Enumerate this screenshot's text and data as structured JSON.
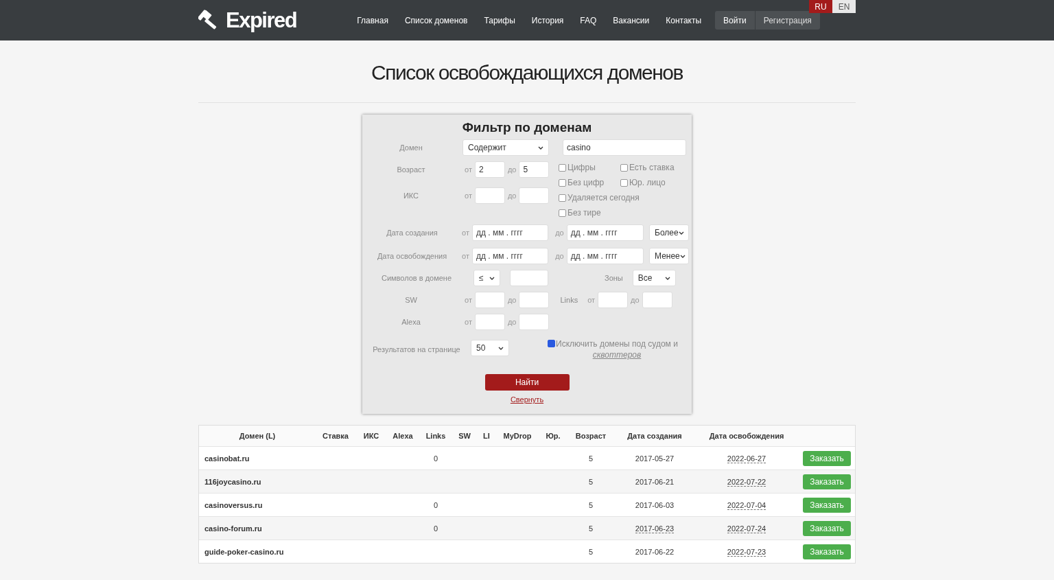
{
  "header": {
    "logo": "Expired",
    "nav": [
      "Главная",
      "Список доменов",
      "Тарифы",
      "История",
      "FAQ",
      "Вакансии",
      "Контакты"
    ],
    "login": "Войти",
    "register": "Регистрация",
    "languages": [
      {
        "label": "RU",
        "selected": true
      },
      {
        "label": "EN",
        "selected": false
      }
    ]
  },
  "page_title": "Список освобождающихся доменов",
  "filter": {
    "title": "Фильтр по доменам",
    "domain": {
      "label": "Домен",
      "mode": "Содержит",
      "value": "casino"
    },
    "age": {
      "label": "Возраст",
      "from_label": "от",
      "from": "2",
      "to_label": "до",
      "to": "5"
    },
    "iks": {
      "label": "ИКС",
      "from_label": "от",
      "to_label": "до"
    },
    "checkboxes": [
      {
        "label": "Цифры",
        "checked": false
      },
      {
        "label": "Есть ставка",
        "checked": false
      },
      {
        "label": "Без цифр",
        "checked": false
      },
      {
        "label": "Юр. лицо",
        "checked": false
      },
      {
        "label": "Удаляется сегодня",
        "checked": false
      },
      {
        "label": "Без тире",
        "checked": false
      }
    ],
    "created": {
      "label": "Дата создания",
      "from_label": "от",
      "from_placeholder": "дд . мм . гггг",
      "to_label": "до",
      "to_placeholder": "дд . мм . гггг",
      "mode": "Более"
    },
    "released": {
      "label": "Дата освобождения",
      "from_label": "от",
      "from_placeholder": "дд . мм . гггг",
      "to_label": "до",
      "to_placeholder": "дд . мм . гггг",
      "mode": "Менее"
    },
    "length": {
      "label": "Символов в домене",
      "op": "≤",
      "zones_label": "Зоны",
      "zones": "Все"
    },
    "sw": {
      "label": "SW",
      "from_label": "от",
      "to_label": "до"
    },
    "links": {
      "label": "Links",
      "from_label": "от",
      "to_label": "до"
    },
    "alexa": {
      "label": "Alexa",
      "from_label": "от",
      "to_label": "до"
    },
    "per_page": {
      "label": "Результатов на странице",
      "value": "50"
    },
    "exclude": {
      "text": "Исключить домены под судом и",
      "link": "сквоттеров",
      "checked": true
    },
    "submit": "Найти",
    "collapse": "Свернуть"
  },
  "table": {
    "columns": [
      "Домен (L)",
      "Ставка",
      "ИКС",
      "Alexa",
      "Links",
      "SW",
      "LI",
      "MyDrop",
      "Юр.",
      "Возраст",
      "Дата создания",
      "Дата освобождения"
    ],
    "rows": [
      {
        "domain": "casinobat.ru",
        "links": "0",
        "age": "5",
        "created": "2017-05-27",
        "created_underlined": false,
        "released": "2022-06-27",
        "action": "Заказать"
      },
      {
        "domain": "116joycasino.ru",
        "age": "5",
        "created": "2017-06-21",
        "created_underlined": false,
        "released": "2022-07-22",
        "action": "Заказать"
      },
      {
        "domain": "casinoversus.ru",
        "links": "0",
        "age": "5",
        "created": "2017-06-03",
        "created_underlined": false,
        "released": "2022-07-04",
        "action": "Заказать"
      },
      {
        "domain": "casino-forum.ru",
        "links": "0",
        "age": "5",
        "created": "2017-06-23",
        "created_underlined": true,
        "released": "2022-07-24",
        "action": "Заказать"
      },
      {
        "domain": "guide-poker-casino.ru",
        "age": "5",
        "created": "2017-06-22",
        "created_underlined": false,
        "released": "2022-07-23",
        "action": "Заказать"
      }
    ]
  }
}
